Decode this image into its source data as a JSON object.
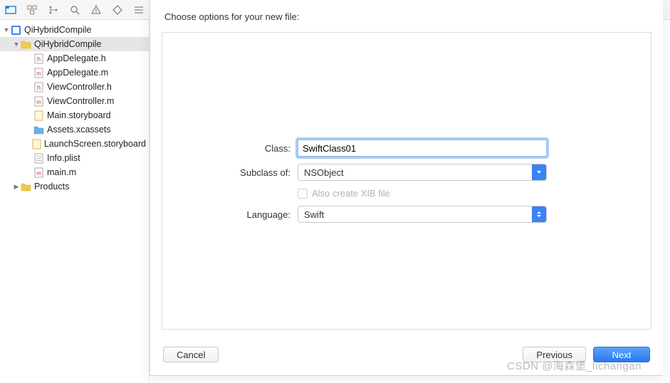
{
  "sheet": {
    "title": "Choose options for your new file:",
    "class_label": "Class:",
    "class_value": "SwiftClass01",
    "subclass_label": "Subclass of:",
    "subclass_value": "NSObject",
    "xib_label": "Also create XIB file",
    "language_label": "Language:",
    "language_value": "Swift",
    "cancel": "Cancel",
    "previous": "Previous",
    "next": "Next"
  },
  "tree": {
    "project": "QiHybridCompile",
    "group": "QiHybridCompile",
    "files": [
      {
        "name": "AppDelegate.h",
        "kind": "h"
      },
      {
        "name": "AppDelegate.m",
        "kind": "m"
      },
      {
        "name": "ViewController.h",
        "kind": "h"
      },
      {
        "name": "ViewController.m",
        "kind": "m"
      },
      {
        "name": "Main.storyboard",
        "kind": "sb"
      },
      {
        "name": "Assets.xcassets",
        "kind": "assets"
      },
      {
        "name": "LaunchScreen.storyboard",
        "kind": "sb"
      },
      {
        "name": "Info.plist",
        "kind": "plist"
      },
      {
        "name": "main.m",
        "kind": "m"
      }
    ],
    "products": "Products"
  },
  "watermark": "CSDN @海森堡_lichangan"
}
